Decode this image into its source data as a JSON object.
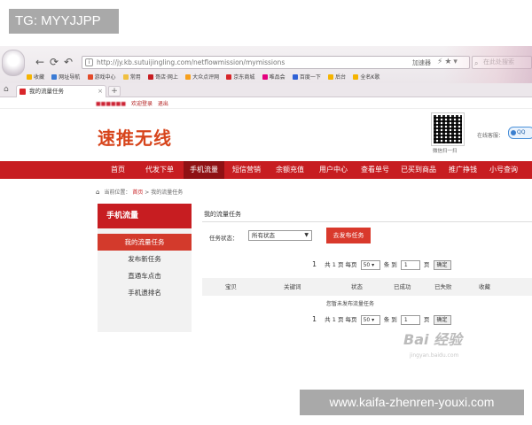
{
  "overlay": {
    "tag": "TG: MYYJJPP",
    "site_url": "www.kaifa-zhenren-youxi.com"
  },
  "browser": {
    "url": "http://jy.kb.sutuijingling.com/netflowmission/mymissions",
    "speed_label": "加速器",
    "search_placeholder": "在此处搜索",
    "bookmarks": [
      "收藏",
      "网址导航",
      "游戏中心",
      "常用",
      "哥店·网上",
      "大众点评网",
      "京东商城",
      "唯品会",
      "百度一下",
      "后台",
      "全名K歌"
    ],
    "tab_title": "我的流量任务",
    "new_tab": "+"
  },
  "site": {
    "top_links": [
      "欢迎登录",
      "退出"
    ],
    "logo": "速推无线",
    "qr_caption": "微信扫一扫",
    "service_label": "在线客服：",
    "qq_label": "QQ",
    "nav": [
      "首页",
      "代发下单",
      "手机流量",
      "短信营销",
      "余额充值",
      "用户中心",
      "查看单号",
      "已买到商品",
      "推广挣钱",
      "小号查询"
    ],
    "breadcrumb": {
      "prefix": "当前位置：",
      "home": "首页",
      "sep": ">",
      "current": "我的流量任务"
    },
    "sidebar": {
      "title": "手机流量",
      "items": [
        "我的流量任务",
        "发布新任务",
        "直通车点击",
        "手机遗排名"
      ]
    },
    "content": {
      "title": "我的流量任务",
      "status_label": "任务状态：",
      "status_value": "所有状态",
      "publish_button": "去发布任务",
      "pager": {
        "page": "1",
        "total": "共 1 页",
        "per_page_label": "每页",
        "per_page": "50",
        "unit": "条",
        "goto_label": "到",
        "goto_value": "1",
        "page_unit": "页",
        "confirm": "确定"
      },
      "columns": [
        "宝贝",
        "关键词",
        "状态",
        "已成功",
        "已失败",
        "收藏"
      ],
      "empty_text": "您暂未发布流量任务"
    },
    "watermark": "Bai 经验",
    "watermark_sub": "jingyan.baidu.com"
  }
}
